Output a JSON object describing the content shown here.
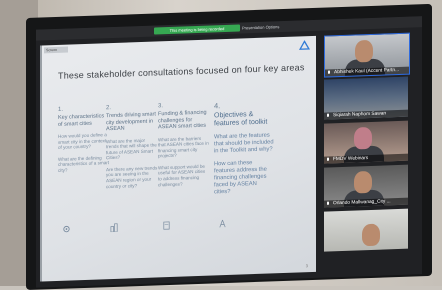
{
  "meeting": {
    "recording_banner": "This meeting is being recorded",
    "share_label": "Presentation Options"
  },
  "slide": {
    "tab_label": "Screen",
    "title": "These stakeholder consultations focused on four key areas",
    "page_number": "3",
    "columns": [
      {
        "number": "1.",
        "heading": "Key characteristics of smart cities",
        "questions": [
          "How would you define a smart city in the context of your country?",
          "What are the defining characteristics of a smart city?"
        ],
        "icon": "gear-icon"
      },
      {
        "number": "2.",
        "heading": "Trends driving smart city development in ASEAN",
        "questions": [
          "What are the major trends that will shape the future of ASEAN Smart Cities?",
          "Are there any new trends you are seeing in the ASEAN region or your country or city?"
        ],
        "icon": "city-icon"
      },
      {
        "number": "3.",
        "heading": "Funding & financing challenges for ASEAN smart cities",
        "questions": [
          "What are the barriers that ASEAN cities face in financing smart city projects?",
          "What support would be useful for ASEAN cities to address financing challenges?"
        ],
        "icon": "document-icon"
      },
      {
        "number": "4.",
        "heading": "Objectives & features of toolkit",
        "questions": [
          "What are the features that should be included in the Toolkit and why?",
          "How can these features address the financing challenges faced by ASEAN cities?"
        ],
        "icon": "tower-icon"
      }
    ]
  },
  "participants": [
    {
      "name": "Abhishek Kaul (Accent Partn...",
      "active_speaker": true
    },
    {
      "name": "Siqiarah Naphom Sawan",
      "active_speaker": false
    },
    {
      "name": "FMDV Webinars",
      "active_speaker": false
    },
    {
      "name": "Orlando Mallwanag_City ...",
      "active_speaker": false
    },
    {
      "name": "",
      "active_speaker": false
    }
  ],
  "colors": {
    "accent": "#2e6be0",
    "recording": "#36a852",
    "slide_text": "#4d6c8c"
  }
}
